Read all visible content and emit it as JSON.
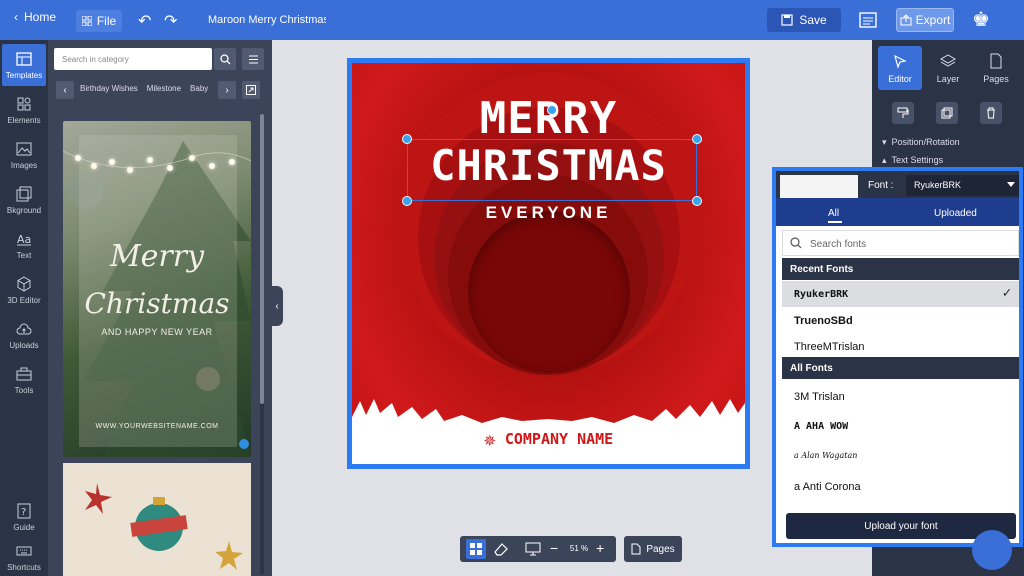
{
  "topbar": {
    "home_label": "Home",
    "file_label": "File",
    "doc_title": "Maroon Merry Christmas Greeting",
    "save_label": "Save",
    "export_label": "Export"
  },
  "rail": {
    "items": [
      {
        "label": "Templates"
      },
      {
        "label": "Elements"
      },
      {
        "label": "Images"
      },
      {
        "label": "Bkground"
      },
      {
        "label": "Text"
      },
      {
        "label": "3D Editor"
      },
      {
        "label": "Uploads"
      },
      {
        "label": "Tools"
      }
    ],
    "guide_label": "Guide",
    "shortcuts_label": "Shortcuts"
  },
  "templates_panel": {
    "search_placeholder": "Search in category",
    "categories": [
      "Birthday Wishes",
      "Milestone",
      "Baby"
    ],
    "thumb1": {
      "merry": "Merry",
      "christmas": "Christmas",
      "subtitle": "AND HAPPY NEW YEAR",
      "website": "WWW.YOURWEBSITENAME.COM"
    }
  },
  "poster": {
    "line1": "MERRY",
    "line2": "CHRISTMAS",
    "line3": "EVERYONE",
    "company": "COMPANY NAME"
  },
  "bottombar": {
    "zoom": "51 %",
    "pages_label": "Pages"
  },
  "right_panel": {
    "tabs": [
      {
        "label": "Editor"
      },
      {
        "label": "Layer"
      },
      {
        "label": "Pages"
      }
    ],
    "sections": [
      "Position/Rotation",
      "Text Settings"
    ]
  },
  "font_popup": {
    "font_label": "Font :",
    "selected_font": "RyukerBRK",
    "tab_all": "All",
    "tab_uploaded": "Uploaded",
    "search_placeholder": "Search fonts",
    "recent_header": "Recent Fonts",
    "recent_fonts": [
      "RyukerBRK",
      "TruenoSBd",
      "ThreeMTrislan"
    ],
    "all_header": "All Fonts",
    "all_fonts": [
      "3M Trislan",
      "A AHA WOW",
      "a Alan Wagatan",
      "a Anti Corona"
    ],
    "upload_label": "Upload your font"
  },
  "colors": {
    "accent": "#3a6fd8",
    "poster_red": "#c31212",
    "selection_blue": "#2d7bf2"
  }
}
